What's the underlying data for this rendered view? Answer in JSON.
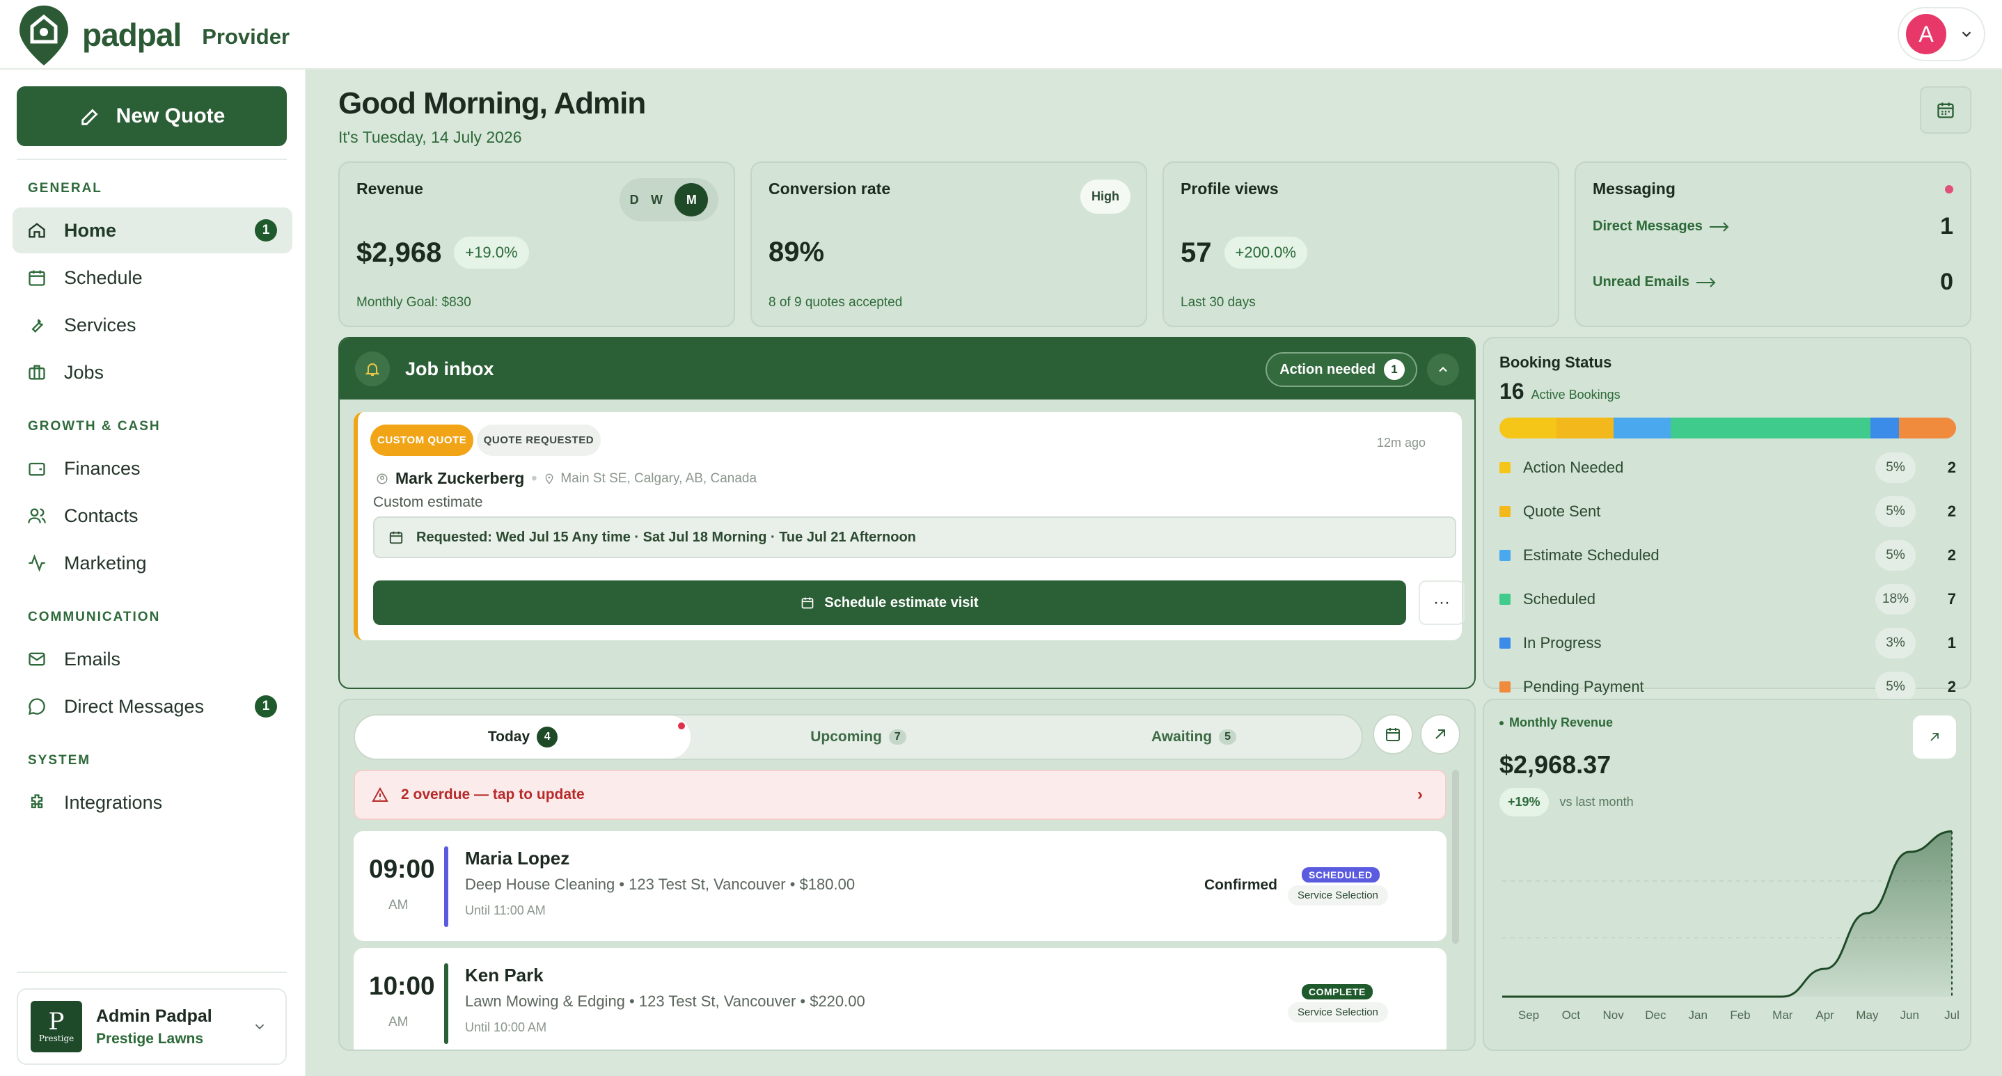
{
  "brand": {
    "name": "padpal",
    "subtitle": "Provider"
  },
  "user": {
    "initial": "A"
  },
  "sidebar": {
    "new_quote": "New Quote",
    "sections": {
      "general": "GENERAL",
      "growth": "GROWTH & CASH",
      "communication": "COMMUNICATION",
      "system": "SYSTEM"
    },
    "items": {
      "home": {
        "label": "Home",
        "badge": "1"
      },
      "schedule": {
        "label": "Schedule"
      },
      "services": {
        "label": "Services"
      },
      "jobs": {
        "label": "Jobs"
      },
      "finances": {
        "label": "Finances"
      },
      "contacts": {
        "label": "Contacts"
      },
      "marketing": {
        "label": "Marketing"
      },
      "emails": {
        "label": "Emails"
      },
      "direct_messages": {
        "label": "Direct Messages",
        "badge": "1"
      },
      "integrations": {
        "label": "Integrations"
      }
    },
    "profile": {
      "name": "Admin Padpal",
      "company": "Prestige Lawns",
      "logo_letter": "P",
      "logo_text": "Prestige"
    }
  },
  "header": {
    "greeting": "Good Morning, Admin",
    "date": "It's Tuesday, 14 July 2026"
  },
  "stats": {
    "revenue": {
      "title": "Revenue",
      "value": "$2,968",
      "delta": "+19.0%",
      "sub": "Monthly Goal: $830",
      "periods": [
        "D",
        "W",
        "M"
      ],
      "selected_period": "M"
    },
    "conversion": {
      "title": "Conversion rate",
      "tag": "High",
      "value": "89%",
      "sub": "8 of 9 quotes accepted"
    },
    "profile_views": {
      "title": "Profile views",
      "value": "57",
      "delta": "+200.0%",
      "sub": "Last 30 days"
    },
    "messaging": {
      "title": "Messaging",
      "direct_label": "Direct Messages",
      "direct_count": "1",
      "unread_label": "Unread Emails",
      "unread_count": "0"
    }
  },
  "inbox": {
    "title": "Job inbox",
    "action_label": "Action needed",
    "action_count": "1",
    "job": {
      "tag1": "CUSTOM QUOTE",
      "tag2": "QUOTE REQUESTED",
      "time_ago": "12m ago",
      "customer": "Mark Zuckerberg",
      "address": "Main St SE, Calgary, AB, Canada",
      "type": "Custom estimate",
      "requested": "Requested: Wed Jul 15 Any time · Sat Jul 18 Morning · Tue Jul 21 Afternoon",
      "cta": "Schedule estimate visit",
      "more": "···"
    }
  },
  "booking": {
    "title": "Booking Status",
    "count": "16",
    "count_label": "Active Bookings",
    "statuses": [
      {
        "label": "Action Needed",
        "pct": "5%",
        "count": "2",
        "value": 2,
        "color": "#f5c518"
      },
      {
        "label": "Quote Sent",
        "pct": "5%",
        "count": "2",
        "value": 2,
        "color": "#f2b81c"
      },
      {
        "label": "Estimate Scheduled",
        "pct": "5%",
        "count": "2",
        "value": 2,
        "color": "#4aa8ee"
      },
      {
        "label": "Scheduled",
        "pct": "18%",
        "count": "7",
        "value": 7,
        "color": "#3fcb8b"
      },
      {
        "label": "In Progress",
        "pct": "3%",
        "count": "1",
        "value": 1,
        "color": "#3b8be8"
      },
      {
        "label": "Pending Payment",
        "pct": "5%",
        "count": "2",
        "value": 2,
        "color": "#f08a3c"
      }
    ],
    "bar_remainder_color": "#2f8a4a"
  },
  "schedule": {
    "tabs": [
      {
        "label": "Today",
        "count": "4"
      },
      {
        "label": "Upcoming",
        "count": "7"
      },
      {
        "label": "Awaiting",
        "count": "5"
      }
    ],
    "overdue": "2 overdue — tap to update",
    "appointments": [
      {
        "time": "09:00",
        "ampm": "AM",
        "name": "Maria Lopez",
        "detail": "Deep House Cleaning • 123 Test St, Vancouver • $180.00",
        "until": "Until 11:00 AM",
        "status": "Confirmed",
        "badge": "SCHEDULED",
        "badge_color": "#5b5be0",
        "service": "Service Selection",
        "bar_color": "#5b5be0"
      },
      {
        "time": "10:00",
        "ampm": "AM",
        "name": "Ken Park",
        "detail": "Lawn Mowing & Edging • 123 Test St, Vancouver • $220.00",
        "until": "Until 10:00 AM",
        "status": "",
        "badge": "COMPLETE",
        "badge_color": "#1f5a2c",
        "service": "Service Selection",
        "bar_color": "#2b5f36"
      }
    ]
  },
  "revenue_chart": {
    "label": "Monthly Revenue",
    "value": "$2,968.37",
    "delta": "+19%",
    "delta_label": "vs last month",
    "chart_data": {
      "type": "area",
      "categories": [
        "Sep",
        "Oct",
        "Nov",
        "Dec",
        "Jan",
        "Feb",
        "Mar",
        "Apr",
        "May",
        "Jun",
        "Jul"
      ],
      "values": [
        0,
        0,
        0,
        0,
        0,
        0,
        0,
        500,
        1500,
        2600,
        2968
      ],
      "ylim": [
        0,
        3100
      ],
      "grid": true
    }
  }
}
